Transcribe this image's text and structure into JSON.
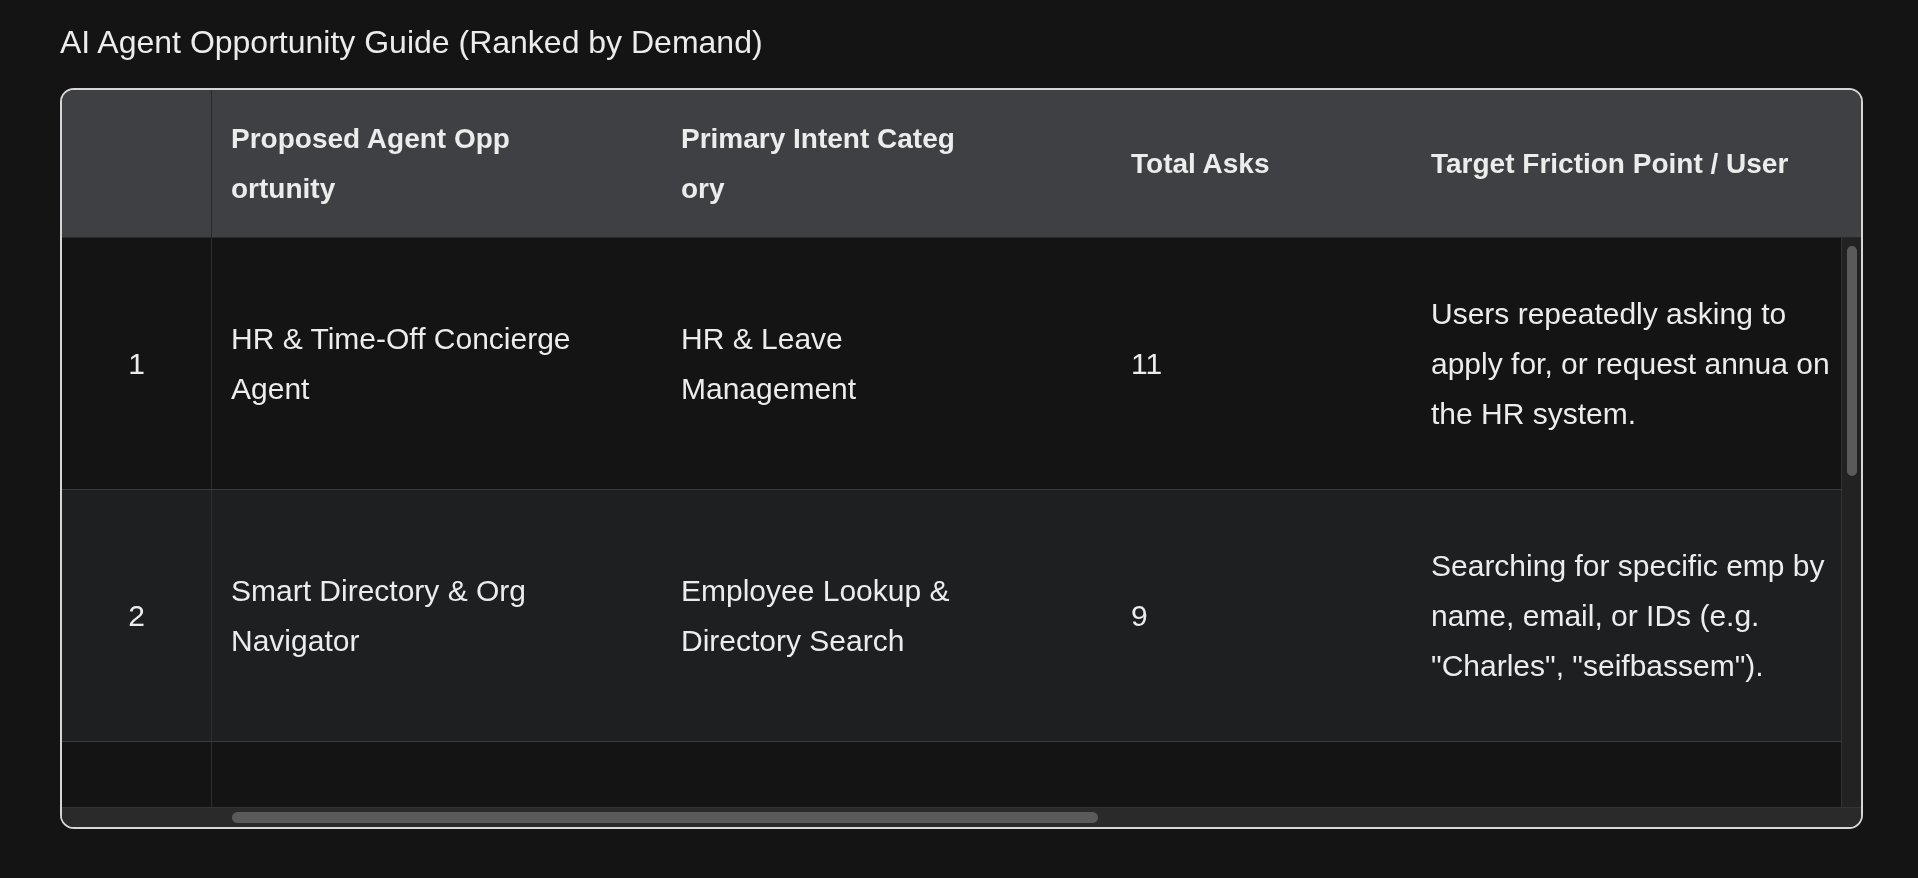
{
  "title": "AI Agent Opportunity Guide (Ranked by Demand)",
  "table": {
    "columns": [
      "Proposed Agent Opportunity",
      "Primary Intent Category",
      "Total Asks",
      "Target Friction Point / User"
    ],
    "rows": [
      {
        "index": "1",
        "cells": [
          "HR & Time-Off Concierge Agent",
          "HR & Leave Management",
          "11",
          "Users repeatedly asking to apply for, or request annua on the HR system."
        ]
      },
      {
        "index": "2",
        "cells": [
          "Smart Directory & Org Navigator",
          "Employee Lookup & Directory Search",
          "9",
          "Searching for specific emp by name, email, or IDs (e.g. \"Charles\", \"seifbassem\")."
        ]
      }
    ]
  }
}
